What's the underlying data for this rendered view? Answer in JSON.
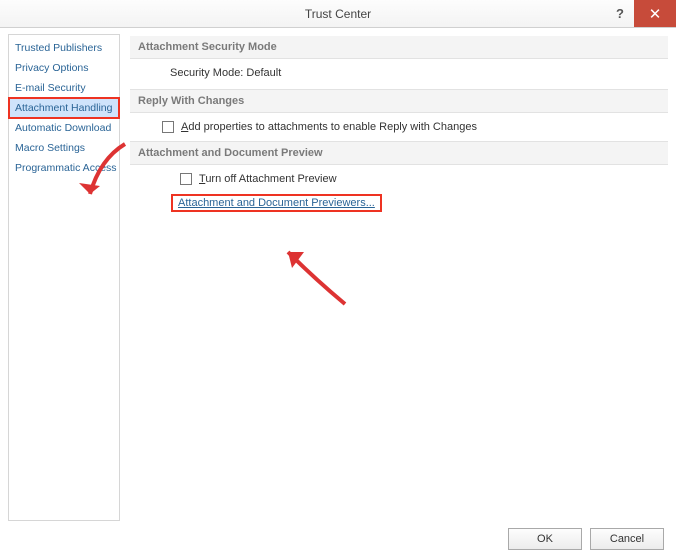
{
  "window": {
    "title": "Trust Center",
    "help_symbol": "?",
    "close_symbol": "✕"
  },
  "sidebar": {
    "items": [
      {
        "label": "Trusted Publishers"
      },
      {
        "label": "Privacy Options"
      },
      {
        "label": "E-mail Security"
      },
      {
        "label": "Attachment Handling"
      },
      {
        "label": "Automatic Download"
      },
      {
        "label": "Macro Settings"
      },
      {
        "label": "Programmatic Access"
      }
    ],
    "selected_index": 3,
    "highlighted_index": 3
  },
  "sections": {
    "attachment_security": {
      "heading": "Attachment Security Mode",
      "mode_text": "Security Mode: Default"
    },
    "reply_with_changes": {
      "heading": "Reply With Changes",
      "checkbox_prefix": "A",
      "checkbox_rest": "dd properties to attachments to enable Reply with Changes"
    },
    "preview": {
      "heading": "Attachment and Document Preview",
      "turnoff_prefix": "T",
      "turnoff_rest": "urn off Attachment Preview",
      "previewers_label": "Attachment and Document Previewers..."
    }
  },
  "footer": {
    "ok": "OK",
    "cancel": "Cancel"
  }
}
